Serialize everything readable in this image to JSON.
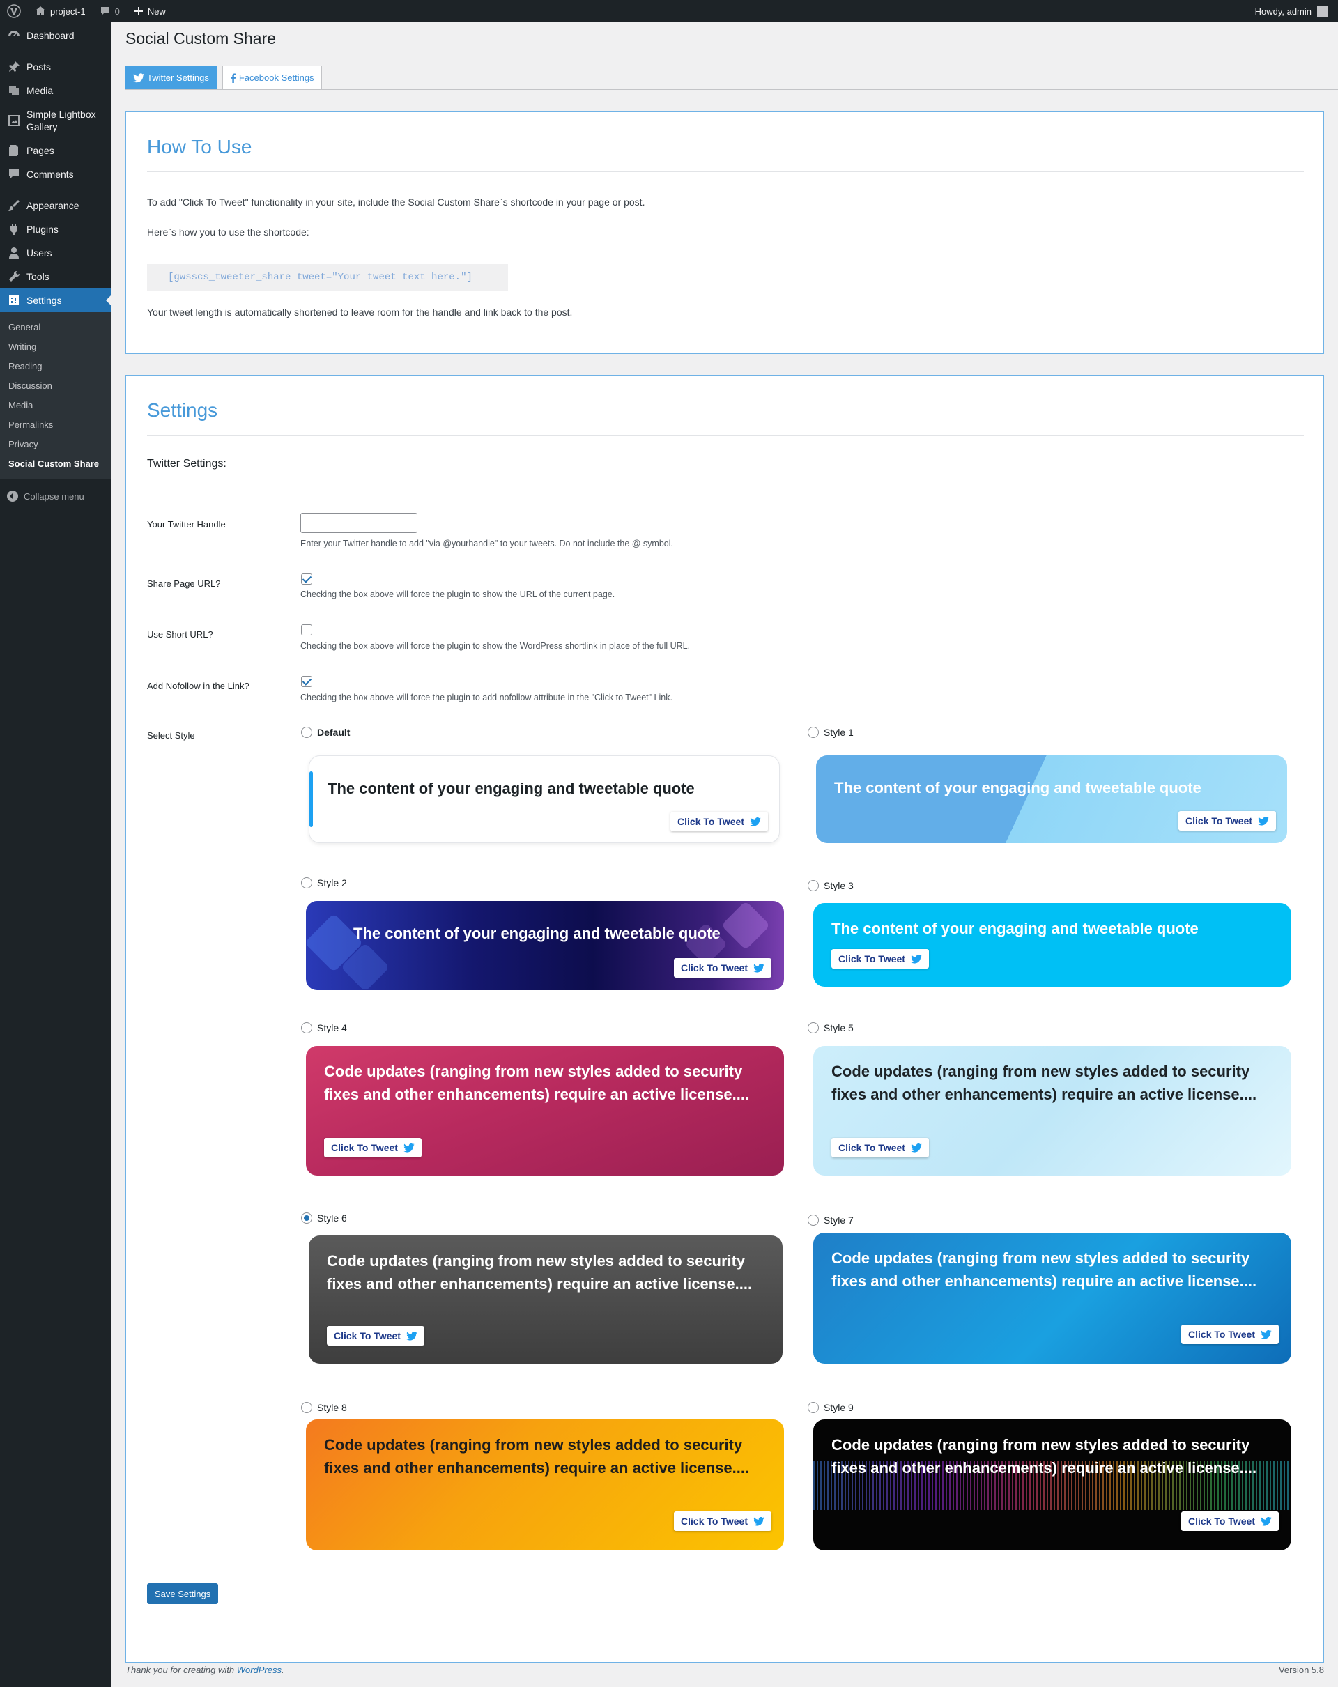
{
  "adminbar": {
    "site": "project-1",
    "comments_count": "0",
    "new_label": "New",
    "howdy": "Howdy, admin"
  },
  "menu": {
    "items": [
      "Dashboard",
      "Posts",
      "Media",
      "Simple Lightbox Gallery",
      "Pages",
      "Comments",
      "Appearance",
      "Plugins",
      "Users",
      "Tools",
      "Settings"
    ],
    "settings_sub": [
      "General",
      "Writing",
      "Reading",
      "Discussion",
      "Media",
      "Permalinks",
      "Privacy",
      "Social Custom Share"
    ],
    "collapse": "Collapse menu"
  },
  "page": {
    "title": "Social Custom Share"
  },
  "tabs": {
    "twitter": "Twitter Settings",
    "facebook": "Facebook Settings"
  },
  "howto": {
    "title": "How To Use",
    "p1": "To add \"Click To Tweet\" functionality in your site, include the Social Custom Share`s shortcode in your page or post.",
    "p2": "Here`s how you to use the shortcode:",
    "code": "[gwsscs_tweeter_share tweet=\"Your tweet text here.\"]",
    "p3": "Your tweet length is automatically shortened to leave room for the handle and link back to the post."
  },
  "settings": {
    "title": "Settings",
    "subtitle": "Twitter Settings:",
    "handle_label": "Your Twitter Handle",
    "handle_value": "",
    "handle_desc": "Enter your Twitter handle to add \"via @yourhandle\" to your tweets. Do not include the @ symbol.",
    "share_label": "Share Page URL?",
    "share_desc": "Checking the box above will force the plugin to show the URL of the current page.",
    "short_label": "Use Short URL?",
    "short_desc": "Checking the box above will force the plugin to show the WordPress shortlink in place of the full URL.",
    "nofollow_label": "Add Nofollow in the Link?",
    "nofollow_desc": "Checking the box above will force the plugin to add nofollow attribute in the \"Click to Tweet\" Link.",
    "style_label": "Select Style",
    "selected_style": "Style 6",
    "save": "Save Settings"
  },
  "styles": {
    "quote_short": "The content of your engaging and tweetable quote",
    "quote_long": "Code updates (ranging from new styles added to security fixes and other enhancements) require an active license....",
    "click": "Click To Tweet",
    "names": [
      "Default",
      "Style 1",
      "Style 2",
      "Style 3",
      "Style 4",
      "Style 5",
      "Style 6",
      "Style 7",
      "Style 8",
      "Style 9"
    ]
  },
  "footer": {
    "text": "Thank you for creating with ",
    "link": "WordPress",
    "period": ".",
    "version": "Version 5.8"
  }
}
